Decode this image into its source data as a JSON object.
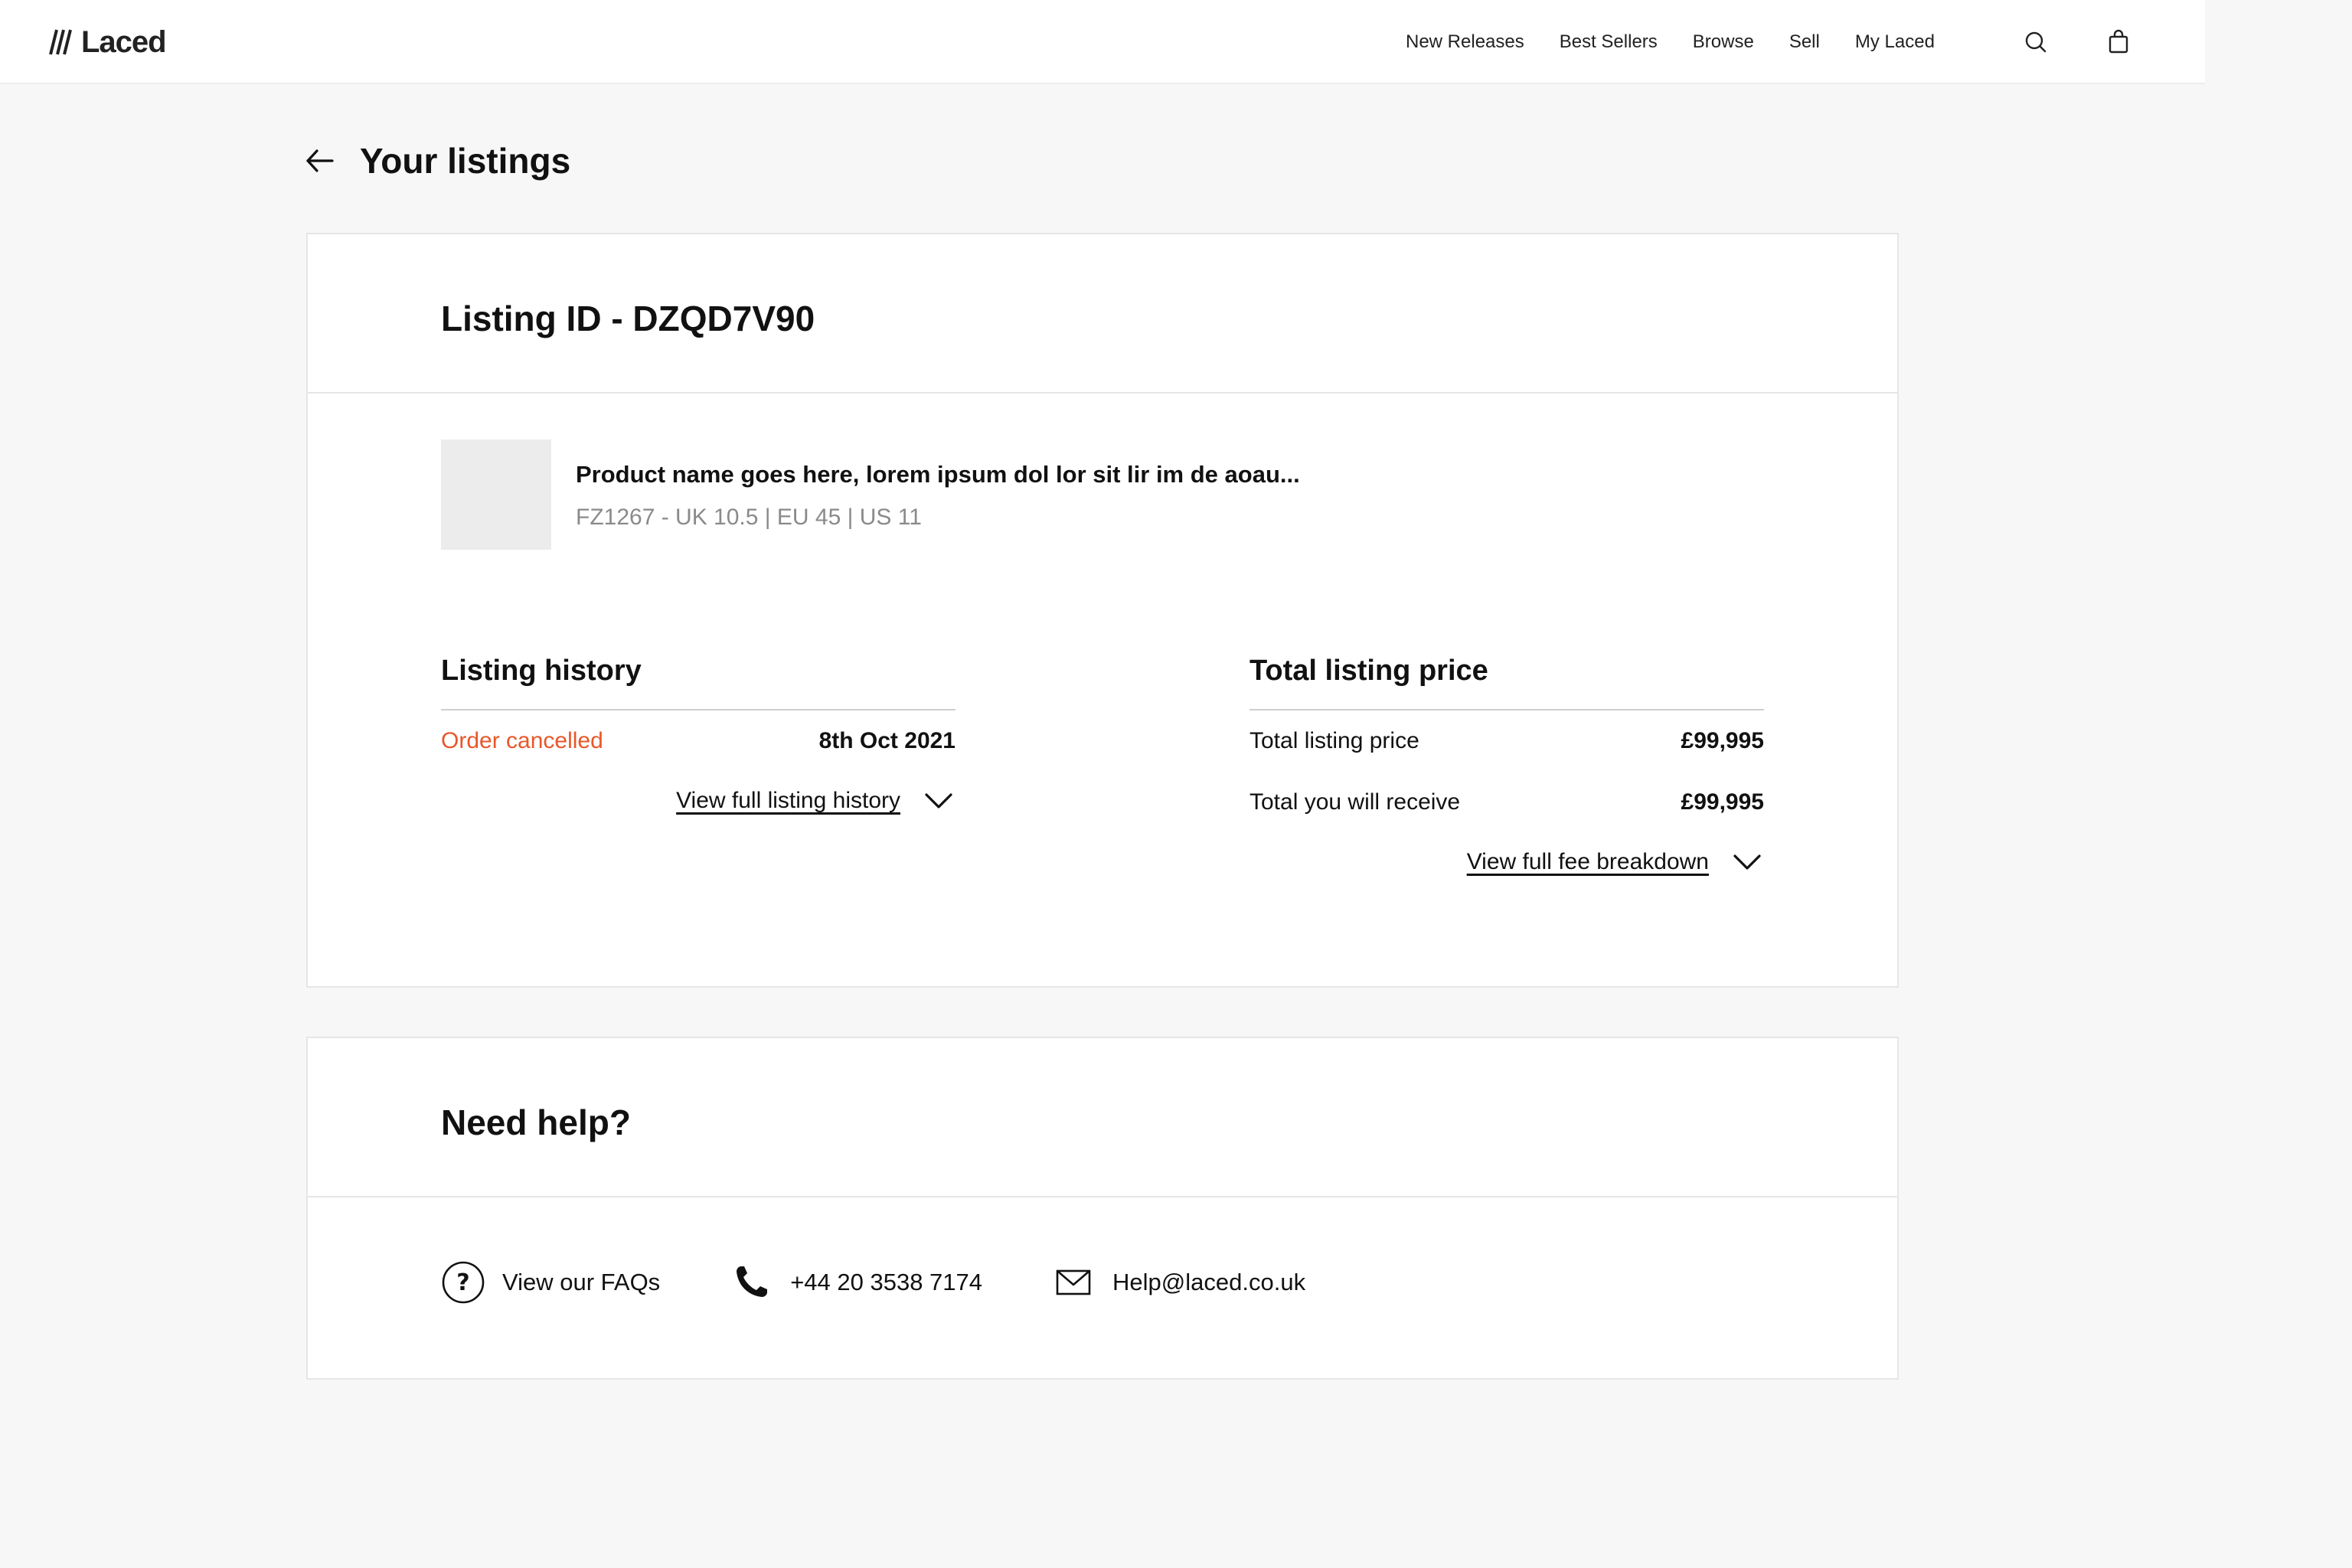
{
  "header": {
    "logo_text": "Laced",
    "nav": [
      "New Releases",
      "Best Sellers",
      "Browse",
      "Sell",
      "My Laced"
    ],
    "icons": [
      "search-icon",
      "bag-icon"
    ]
  },
  "page": {
    "title": "Your listings",
    "back_icon": "arrow-left-icon"
  },
  "listing": {
    "title": "Listing ID - DZQD7V90",
    "product": {
      "name": "Product name goes here, lorem ipsum dol lor sit lir im de aoau...",
      "meta": "FZ1267 -  UK 10.5 | EU 45 | US 11"
    },
    "history": {
      "title": "Listing history",
      "status": "Order cancelled",
      "date": "8th Oct 2021",
      "link": "View full listing history"
    },
    "price": {
      "title": "Total listing price",
      "rows": [
        {
          "label": "Total listing price",
          "value": "£99,995"
        },
        {
          "label": "Total you will receive",
          "value": "£99,995"
        }
      ],
      "link": "View full fee breakdown"
    }
  },
  "help": {
    "title": "Need help?",
    "faqs": "View our FAQs",
    "phone": "+44 20 3538 7174",
    "email": "Help@laced.co.uk"
  },
  "colors": {
    "accent_status": "#e8572a",
    "background": "#f7f7f7",
    "card": "#ffffff"
  }
}
